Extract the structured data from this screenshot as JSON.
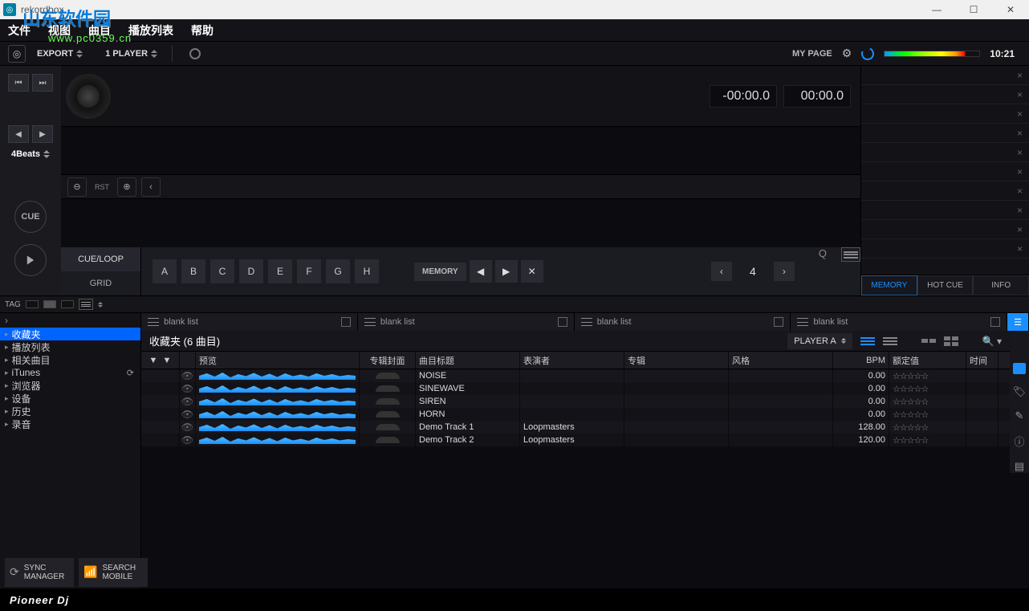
{
  "window": {
    "title": "rekordbox"
  },
  "watermark": {
    "big": "山东软件园",
    "url": "www.pc0359.cn"
  },
  "menu": {
    "file": "文件",
    "view": "视图",
    "track": "曲目",
    "playlist": "播放列表",
    "help": "帮助"
  },
  "modebar": {
    "export": "EXPORT",
    "player_mode": "1 PLAYER",
    "mypage": "MY PAGE",
    "clock": "10:21"
  },
  "leftcol": {
    "beats": "4Beats",
    "cue": "CUE"
  },
  "player": {
    "time_neg": "-00:00.0",
    "time_pos": "00:00.0",
    "rst": "RST"
  },
  "cueloop": {
    "tab_cue": "CUE/LOOP",
    "tab_grid": "GRID",
    "pads": [
      "A",
      "B",
      "C",
      "D",
      "E",
      "F",
      "G",
      "H"
    ],
    "memory": "MEMORY",
    "beatjump": "4",
    "q": "Q"
  },
  "rightpane": {
    "tabs": {
      "memory": "MEMORY",
      "hotcue": "HOT CUE",
      "info": "INFO"
    }
  },
  "tagrow": {
    "tag": "TAG"
  },
  "tree": {
    "items": [
      {
        "label": "收藏夹",
        "sel": true
      },
      {
        "label": "播放列表"
      },
      {
        "label": "相关曲目"
      },
      {
        "label": "iTunes",
        "sync": true
      },
      {
        "label": "浏览器"
      },
      {
        "label": "设备"
      },
      {
        "label": "历史"
      },
      {
        "label": "录音"
      }
    ]
  },
  "blank_lists": {
    "l0": "blank list",
    "l1": "blank list",
    "l2": "blank list",
    "l3": "blank list"
  },
  "list": {
    "title": "收藏夹 (6 曲目)",
    "player_sel": "PLAYER A",
    "cols": {
      "preview": "预览",
      "cover": "专辑封面",
      "title": "曲目标题",
      "artist": "表演者",
      "album": "专辑",
      "genre": "风格",
      "bpm": "BPM",
      "rating": "额定值",
      "time": "时间"
    },
    "rows": [
      {
        "title": "NOISE",
        "artist": "",
        "bpm": "0.00"
      },
      {
        "title": "SINEWAVE",
        "artist": "",
        "bpm": "0.00"
      },
      {
        "title": "SIREN",
        "artist": "",
        "bpm": "0.00"
      },
      {
        "title": "HORN",
        "artist": "",
        "bpm": "0.00"
      },
      {
        "title": "Demo Track 1",
        "artist": "Loopmasters",
        "bpm": "128.00"
      },
      {
        "title": "Demo Track 2",
        "artist": "Loopmasters",
        "bpm": "120.00"
      }
    ]
  },
  "bottom": {
    "sync": "SYNC\nMANAGER",
    "search": "SEARCH\nMOBILE"
  },
  "footer": {
    "logo": "Pioneer Dj"
  }
}
